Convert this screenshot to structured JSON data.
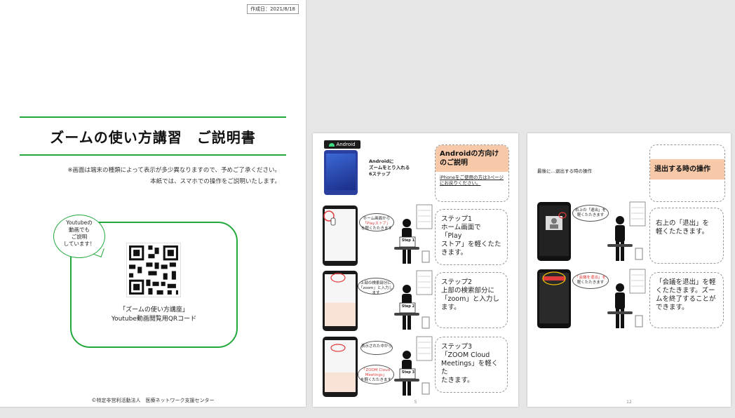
{
  "cover": {
    "date": "作成日：2021/8/18",
    "title": "ズームの使い方講習　ご説明書",
    "note1": "※画面は端末の種類によって表示が多少異なりますので、予めご了承ください。",
    "note2": "本紙では、スマホでの操作をご説明いたします。",
    "bubble": [
      "Youtubeの",
      "動画でも",
      "ご説明",
      "しています！"
    ],
    "qr_caption1": "「ズームの使い方講座」",
    "qr_caption2": "Youtube動画閲覧用QRコード",
    "footer": "©特定非営利活動法人　医療ネットワーク支援センター"
  },
  "page5": {
    "badge": "Android",
    "intro": [
      "Androidに",
      "ズームをとり入れる",
      "6ステップ"
    ],
    "heading": "Androidの方向けのご説明",
    "heading_link": "iPhoneをご使用の方は3ページにお戻りください。",
    "steps": [
      {
        "speech": [
          "ホーム画面から",
          "「Playストア」",
          "を軽くたたきます"
        ],
        "sign": "Step 1",
        "text": [
          "ステップ1",
          "ホーム画面で「Play",
          "ストア」を軽くたた",
          "きます。"
        ]
      },
      {
        "speech": [
          "上部の検索部分に",
          "「zoom」と入力します"
        ],
        "sign": "Step 2",
        "text": [
          "ステップ2",
          "上部の検索部分に",
          "「zoom」と入力し",
          "ます。"
        ]
      },
      {
        "speech": [
          "表示された中から",
          "「ZOOM Cloud Meetings」",
          "を軽くたたきます"
        ],
        "sign": "Step 3",
        "text": [
          "ステップ3",
          "「ZOOM Cloud",
          "Meetings」を軽くた",
          "たきます。"
        ]
      }
    ],
    "page_number": "5"
  },
  "page12": {
    "lead": "最後に…退出する時の操作",
    "heading": "退出する時の操作",
    "steps": [
      {
        "speech": [
          "右上の「退出」を",
          "軽くたたきます"
        ],
        "text": [
          "右上の「退出」を",
          "軽くたたきます。"
        ]
      },
      {
        "speech": [
          "「会議を退出」を",
          "軽くたたきます"
        ],
        "text": [
          "「会議を退出」を軽",
          "くたたきます。ズー",
          "ムを終了することが",
          "できます。"
        ]
      }
    ],
    "page_number": "12"
  },
  "colors": {
    "accent_green": "#22a83b",
    "heading_band": "#f7c9a9",
    "alert_red": "#e03b3b"
  }
}
